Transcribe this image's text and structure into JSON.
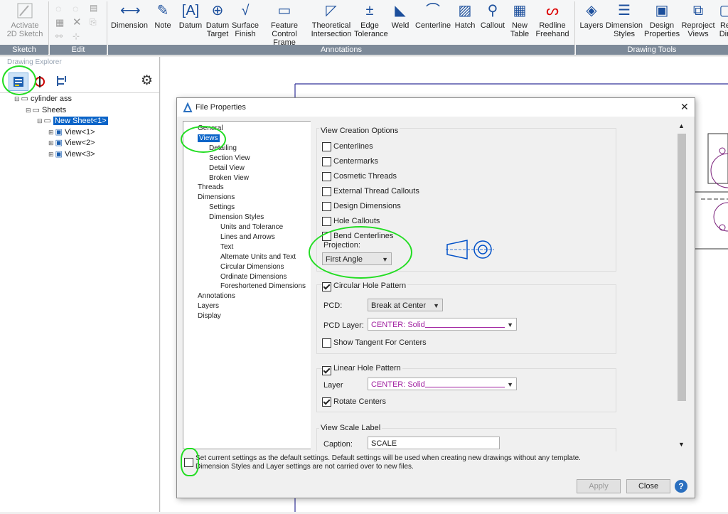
{
  "ribbon": {
    "sketch": {
      "activate_label": "Activate\n2D Sketch",
      "group": "Sketch"
    },
    "edit": {
      "group": "Edit"
    },
    "annotations": {
      "group": "Annotations",
      "buttons": [
        {
          "label": "Dimension",
          "icon": "dimension-icon"
        },
        {
          "label": "Note",
          "icon": "note-icon"
        },
        {
          "label": "Datum",
          "icon": "datum-icon"
        },
        {
          "label": "Datum\nTarget",
          "icon": "datum-target-icon"
        },
        {
          "label": "Surface\nFinish",
          "icon": "surface-finish-icon"
        },
        {
          "label": "Feature\nControl Frame",
          "icon": "feature-control-frame-icon"
        },
        {
          "label": "Theoretical\nIntersection",
          "icon": "theoretical-intersection-icon"
        },
        {
          "label": "Edge\nTolerance",
          "icon": "edge-tolerance-icon"
        },
        {
          "label": "Weld",
          "icon": "weld-icon"
        },
        {
          "label": "Centerline",
          "icon": "centerline-icon"
        },
        {
          "label": "Hatch",
          "icon": "hatch-icon"
        },
        {
          "label": "Callout",
          "icon": "callout-icon"
        },
        {
          "label": "New\nTable",
          "icon": "table-icon"
        },
        {
          "label": "Redline\nFreehand",
          "icon": "redline-icon"
        }
      ]
    },
    "drawing_tools": {
      "group": "Drawing Tools",
      "buttons": [
        {
          "label": "Layers",
          "icon": "layers-icon"
        },
        {
          "label": "Dimension\nStyles",
          "icon": "dimension-styles-icon"
        },
        {
          "label": "Design\nProperties",
          "icon": "design-properties-icon"
        },
        {
          "label": "Reproject\nViews",
          "icon": "reproject-icon"
        },
        {
          "label": "Re\nDin",
          "icon": "more-icon"
        }
      ]
    }
  },
  "explorer": {
    "title": "Drawing Explorer",
    "tree": [
      {
        "label": "cylinder ass",
        "level": 0
      },
      {
        "label": "Sheets",
        "level": 1
      },
      {
        "label": "New Sheet<1>",
        "level": 2,
        "selected": true
      },
      {
        "label": "View<1>",
        "level": 3
      },
      {
        "label": "View<2>",
        "level": 3
      },
      {
        "label": "View<3>",
        "level": 3
      }
    ]
  },
  "dialog": {
    "title": "File Properties",
    "nav": [
      {
        "label": "General",
        "level": 0
      },
      {
        "label": "Views",
        "level": 0,
        "selected": true
      },
      {
        "label": "Detailing",
        "level": 1
      },
      {
        "label": "Section View",
        "level": 1
      },
      {
        "label": "Detail View",
        "level": 1
      },
      {
        "label": "Broken View",
        "level": 1
      },
      {
        "label": "Threads",
        "level": 0
      },
      {
        "label": "Dimensions",
        "level": 0
      },
      {
        "label": "Settings",
        "level": 1
      },
      {
        "label": "Dimension Styles",
        "level": 1
      },
      {
        "label": "Units and Tolerance",
        "level": 2
      },
      {
        "label": "Lines and Arrows",
        "level": 2
      },
      {
        "label": "Text",
        "level": 2
      },
      {
        "label": "Alternate Units and Text",
        "level": 2
      },
      {
        "label": "Circular Dimensions",
        "level": 2
      },
      {
        "label": "Ordinate Dimensions",
        "level": 2
      },
      {
        "label": "Foreshortened Dimensions",
        "level": 2
      },
      {
        "label": "Annotations",
        "level": 0
      },
      {
        "label": "Layers",
        "level": 0
      },
      {
        "label": "Display",
        "level": 0
      }
    ],
    "view_creation": {
      "title": "View Creation Options",
      "options": [
        {
          "label": "Centerlines",
          "checked": false
        },
        {
          "label": "Centermarks",
          "checked": false
        },
        {
          "label": "Cosmetic Threads",
          "checked": false
        },
        {
          "label": "External Thread Callouts",
          "checked": false
        },
        {
          "label": "Design Dimensions",
          "checked": false
        },
        {
          "label": "Hole Callouts",
          "checked": false
        },
        {
          "label": "Bend Centerlines",
          "checked": false
        }
      ],
      "projection_label": "Projection:",
      "projection_value": "First Angle"
    },
    "circular": {
      "title": "Circular Hole Pattern",
      "checked": true,
      "pcd_label": "PCD:",
      "pcd_value": "Break at Center",
      "layer_label": "PCD Layer:",
      "layer_value": "CENTER: Solid",
      "tangent_label": "Show Tangent For Centers",
      "tangent_checked": false
    },
    "linear": {
      "title": "Linear Hole Pattern",
      "checked": true,
      "layer_label": "Layer",
      "layer_value": "CENTER: Solid",
      "rotate_label": "Rotate Centers",
      "rotate_checked": true
    },
    "scale_label": {
      "title": "View Scale Label",
      "caption_label": "Caption:",
      "caption_value": "SCALE"
    },
    "default_note_1": "Set current settings as the default settings. Default settings will be used when creating new drawings without any template.",
    "default_note_2": "Dimension Styles and Layer settings are not carried over to new files.",
    "apply_label": "Apply",
    "close_label": "Close",
    "help_label": "?",
    "close_x": "✕"
  },
  "colors": {
    "accent": "#0a64c8",
    "selection": "#cce4f7",
    "annotation": "#22dd22",
    "layer_text": "#a020a0"
  }
}
